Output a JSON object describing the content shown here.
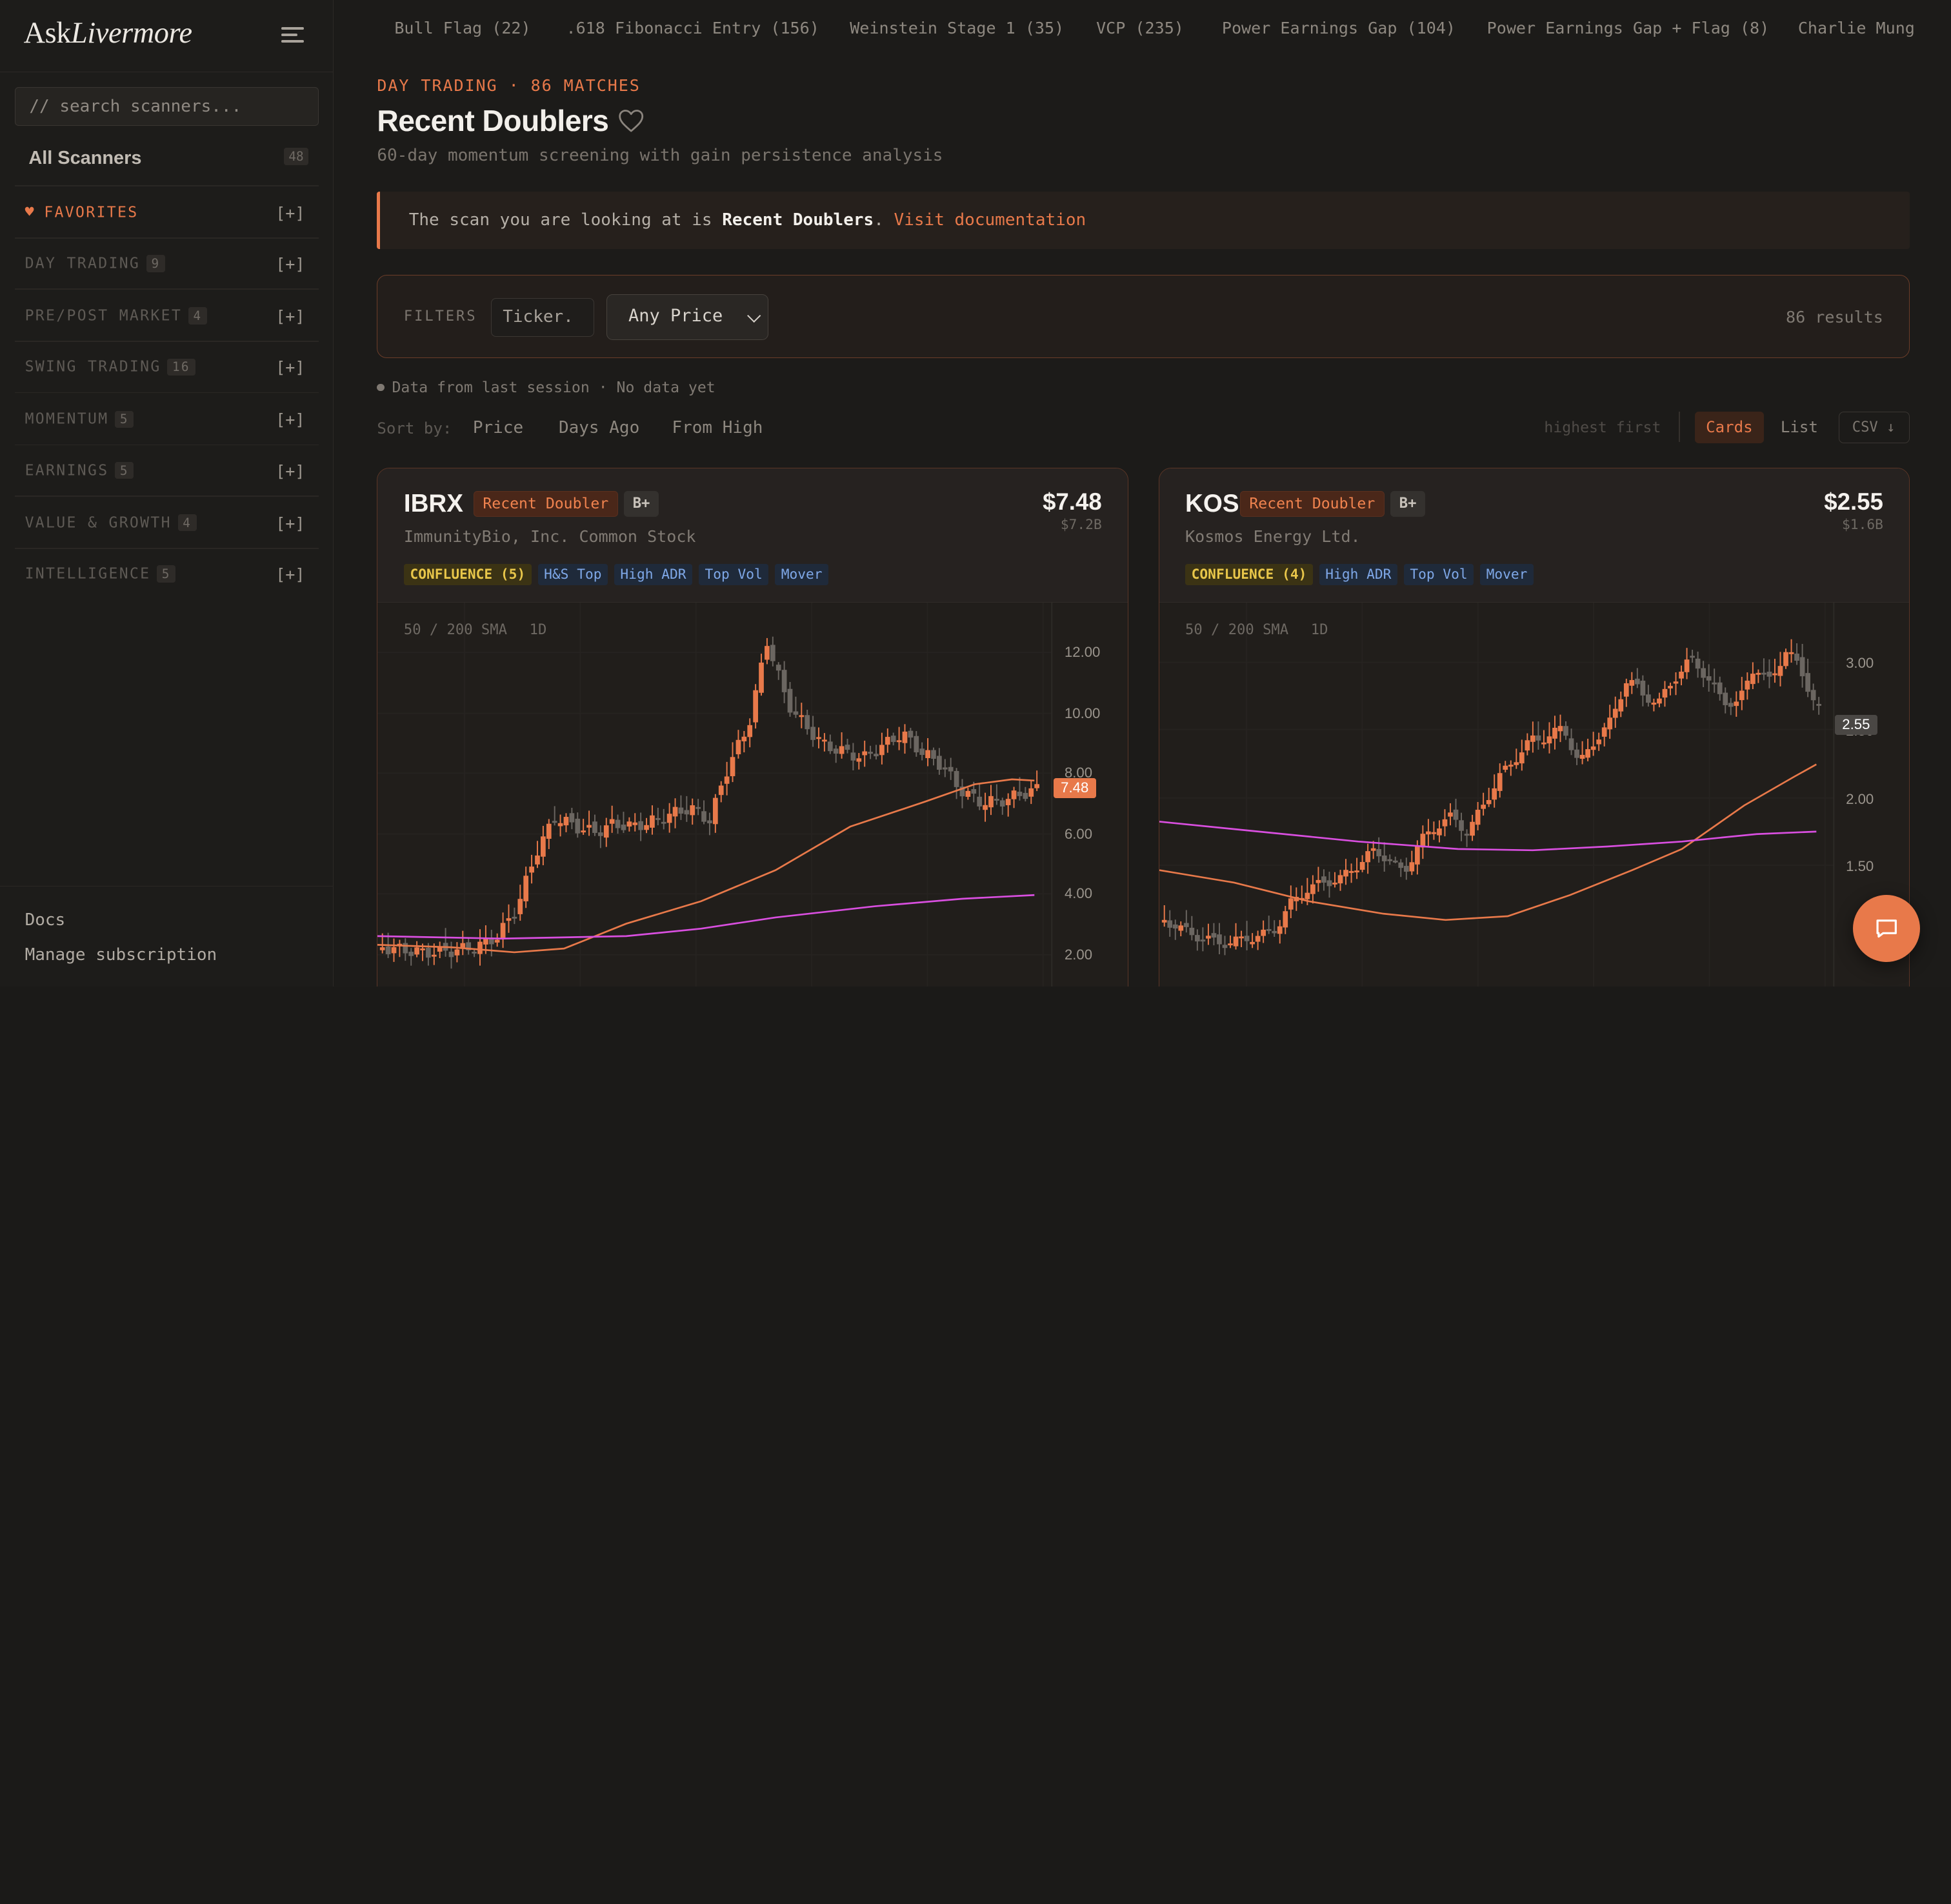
{
  "brand": {
    "logo_part1": "Ask",
    "logo_part2": "Livermore"
  },
  "sidebar": {
    "search_placeholder": "// search scanners...",
    "all_scanners": {
      "label": "All Scanners",
      "count": "48"
    },
    "favorites": {
      "label": "FAVORITES",
      "heart": "♥",
      "add": "[+]"
    },
    "categories": [
      {
        "label": "DAY TRADING",
        "count": "9",
        "add": "[+]"
      },
      {
        "label": "PRE/POST MARKET",
        "count": "4",
        "add": "[+]"
      },
      {
        "label": "SWING TRADING",
        "count": "16",
        "add": "[+]"
      },
      {
        "label": "MOMENTUM",
        "count": "5",
        "add": "[+]"
      },
      {
        "label": "EARNINGS",
        "count": "5",
        "add": "[+]"
      },
      {
        "label": "VALUE & GROWTH",
        "count": "4",
        "add": "[+]"
      },
      {
        "label": "INTELLIGENCE",
        "count": "5",
        "add": "[+]"
      }
    ],
    "footer": {
      "docs": "Docs",
      "manage": "Manage subscription"
    }
  },
  "scanner_strip": [
    "Bull Flag (22)",
    ".618 Fibonacci Entry (156)",
    "Weinstein Stage 1 (35)",
    "VCP (235)",
    "Power Earnings Gap (104)",
    "Power Earnings Gap + Flag (8)",
    "Charlie Mung"
  ],
  "header": {
    "kicker": "DAY TRADING · 86 MATCHES",
    "title": "Recent Doublers",
    "subtitle": "60-day momentum screening with gain persistence analysis"
  },
  "notice": {
    "prefix": "The scan you are looking at is ",
    "scan_name": "Recent Doublers",
    "dot": ".",
    "link": "Visit documentation"
  },
  "filters": {
    "label": "FILTERS",
    "ticker_placeholder": "Ticker.",
    "price_value": "Any Price",
    "results": "86 results"
  },
  "data_note": "Data from last session · No data yet",
  "sort": {
    "label": "Sort by:",
    "options": [
      "Price",
      "Days Ago",
      "From High"
    ],
    "order": "highest first",
    "views": {
      "cards": "Cards",
      "list": "List"
    },
    "csv": "CSV ↓"
  },
  "cards": [
    {
      "symbol": "IBRX",
      "badge": "Recent Doubler",
      "grade": "B+",
      "price": "$7.48",
      "market_cap": "$7.2B",
      "company": "ImmunityBio, Inc. Common Stock",
      "confluence": "CONFLUENCE (5)",
      "tags": [
        "H&S Top",
        "High ADR",
        "Top Vol",
        "Mover"
      ],
      "chart_meta": {
        "sma": "50 / 200 SMA",
        "timeframe": "1D"
      },
      "y_ticks": [
        "12.00",
        "10.00",
        "8.00",
        "6.00",
        "4.00",
        "2.00"
      ],
      "last_price_label": "7.48"
    },
    {
      "symbol": "KOS",
      "badge": "Recent Doubler",
      "grade": "B+",
      "price": "$2.55",
      "market_cap": "$1.6B",
      "company": "Kosmos Energy Ltd.",
      "confluence": "CONFLUENCE (4)",
      "tags": [
        "High ADR",
        "Top Vol",
        "Mover"
      ],
      "chart_meta": {
        "sma": "50 / 200 SMA",
        "timeframe": "1D"
      },
      "y_ticks": [
        "3.00",
        "2.50",
        "2.00",
        "1.50"
      ],
      "last_price_label": "2.55"
    }
  ],
  "colors": {
    "accent": "#e8794a",
    "candle_up": "#e8794a",
    "candle_down": "#6b6661",
    "sma50": "#e8794a",
    "sma200": "#d94fe0",
    "tag_blue": "#7fa8e8",
    "confluence_yellow": "#e8c64a"
  },
  "icons": {
    "menu": "hamburger-menu-icon",
    "favorite": "heart-outline-icon",
    "chat": "chat-bubble-icon",
    "select": "chevron-down-icon"
  }
}
